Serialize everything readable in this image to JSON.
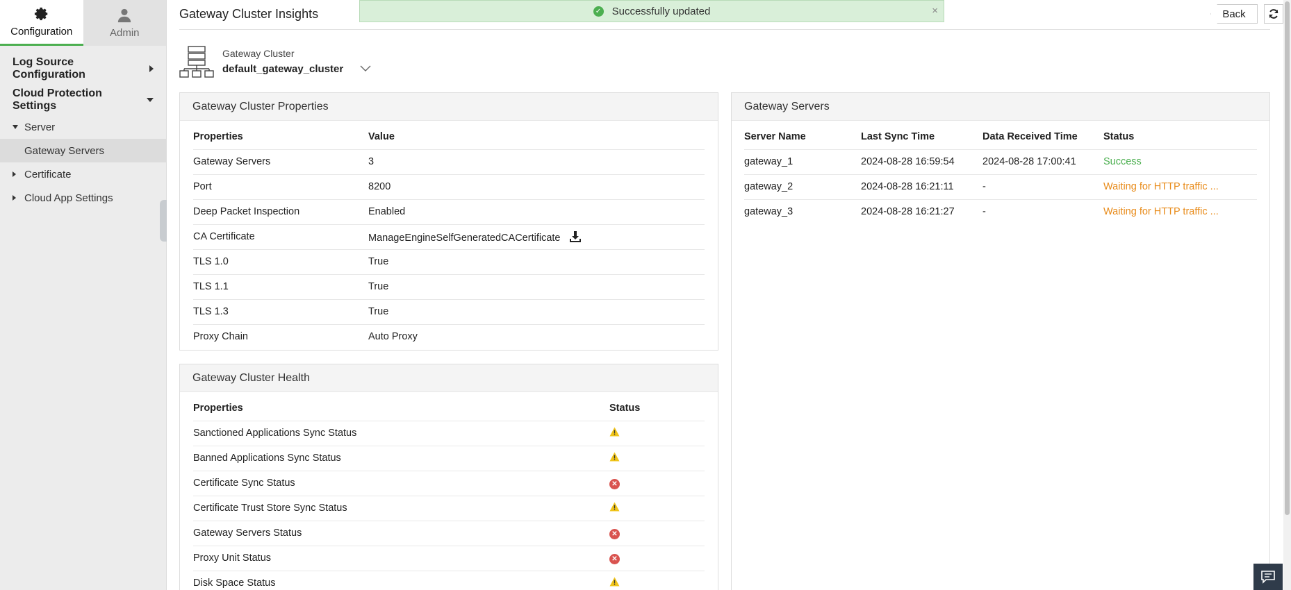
{
  "sidebar": {
    "tabs": [
      {
        "label": "Configuration",
        "icon": "gear-icon",
        "active": true
      },
      {
        "label": "Admin",
        "icon": "user-icon",
        "active": false
      }
    ],
    "sections": [
      {
        "label": "Log Source Configuration",
        "expanded": false
      },
      {
        "label": "Cloud Protection Settings",
        "expanded": true
      }
    ],
    "tree": {
      "server": "Server",
      "gateway_servers": "Gateway Servers",
      "certificate": "Certificate",
      "cloud_app_settings": "Cloud App Settings"
    }
  },
  "header": {
    "title": "Gateway Cluster Insights",
    "toast": "Successfully updated",
    "back": "Back"
  },
  "cluster": {
    "label": "Gateway Cluster",
    "name": "default_gateway_cluster"
  },
  "properties_panel": {
    "title": "Gateway Cluster Properties",
    "columns": [
      "Properties",
      "Value"
    ],
    "rows": [
      {
        "property": "Gateway Servers",
        "value": "3"
      },
      {
        "property": "Port",
        "value": "8200"
      },
      {
        "property": "Deep Packet Inspection",
        "value": "Enabled"
      },
      {
        "property": "CA Certificate",
        "value": "ManageEngineSelfGeneratedCACertificate"
      },
      {
        "property": "TLS 1.0",
        "value": "True"
      },
      {
        "property": "TLS 1.1",
        "value": "True"
      },
      {
        "property": "TLS 1.3",
        "value": "True"
      },
      {
        "property": "Proxy Chain",
        "value": "Auto Proxy"
      }
    ]
  },
  "health_panel": {
    "title": "Gateway Cluster Health",
    "columns": [
      "Properties",
      "Status"
    ],
    "rows": [
      {
        "property": "Sanctioned Applications Sync Status",
        "status": "warning"
      },
      {
        "property": "Banned Applications Sync Status",
        "status": "warning"
      },
      {
        "property": "Certificate Sync Status",
        "status": "error"
      },
      {
        "property": "Certificate Trust Store Sync Status",
        "status": "warning"
      },
      {
        "property": "Gateway Servers Status",
        "status": "error"
      },
      {
        "property": "Proxy Unit Status",
        "status": "error"
      },
      {
        "property": "Disk Space Status",
        "status": "warning"
      }
    ]
  },
  "servers_panel": {
    "title": "Gateway Servers",
    "columns": [
      "Server Name",
      "Last Sync Time",
      "Data Received Time",
      "Status"
    ],
    "rows": [
      {
        "name": "gateway_1",
        "last_sync": "2024-08-28 16:59:54",
        "data_received": "2024-08-28 17:00:41",
        "status": "Success",
        "kind": "ok"
      },
      {
        "name": "gateway_2",
        "last_sync": "2024-08-28 16:21:11",
        "data_received": "-",
        "status": "Waiting for HTTP traffic ...",
        "kind": "wait"
      },
      {
        "name": "gateway_3",
        "last_sync": "2024-08-28 16:21:27",
        "data_received": "-",
        "status": "Waiting for HTTP traffic ...",
        "kind": "wait"
      }
    ]
  },
  "colors": {
    "success": "#4caf50",
    "waiting": "#e88b1a",
    "warning": "#f0c419",
    "error": "#d9534f"
  }
}
